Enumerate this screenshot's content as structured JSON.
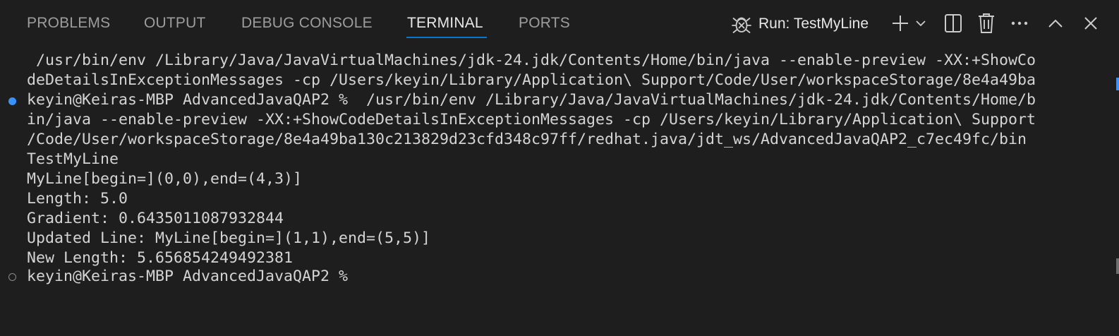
{
  "panel": {
    "tabs": [
      {
        "label": "PROBLEMS"
      },
      {
        "label": "OUTPUT"
      },
      {
        "label": "DEBUG CONSOLE"
      },
      {
        "label": "TERMINAL",
        "active": true
      },
      {
        "label": "PORTS"
      }
    ],
    "run_label": "Run: TestMyLine"
  },
  "icons": {
    "debug": "bug-icon",
    "add": "plus-icon",
    "dropdown": "chevron-down-icon",
    "split": "split-terminal-icon",
    "kill": "trash-icon",
    "more": "ellipsis-icon",
    "maximize": "chevron-up-icon",
    "close": "close-icon"
  },
  "colors": {
    "background": "#1e1e1e",
    "active_tab_underline": "#0078d4",
    "command_decoration": "#3794ff"
  },
  "terminal": {
    "lines": [
      " /usr/bin/env /Library/Java/JavaVirtualMachines/jdk-24.jdk/Contents/Home/bin/java --enable-preview -XX:+ShowCo",
      "deDetailsInExceptionMessages -cp /Users/keyin/Library/Application\\ Support/Code/User/workspaceStorage/8e4a49ba",
      "keyin@Keiras-MBP AdvancedJavaQAP2 %  /usr/bin/env /Library/Java/JavaVirtualMachines/jdk-24.jdk/Contents/Home/b",
      "in/java --enable-preview -XX:+ShowCodeDetailsInExceptionMessages -cp /Users/keyin/Library/Application\\ Support",
      "/Code/User/workspaceStorage/8e4a49ba130c213829d23cfd348c97ff/redhat.java/jdt_ws/AdvancedJavaQAP2_c7ec49fc/bin ",
      "TestMyLine",
      "MyLine[begin=](0,0),end=(4,3)]",
      "Length: 5.0",
      "Gradient: 0.6435011087932844",
      "Updated Line: MyLine[begin=](1,1),end=(5,5)]",
      "New Length: 5.656854249492381",
      "keyin@Keiras-MBP AdvancedJavaQAP2 % "
    ]
  }
}
